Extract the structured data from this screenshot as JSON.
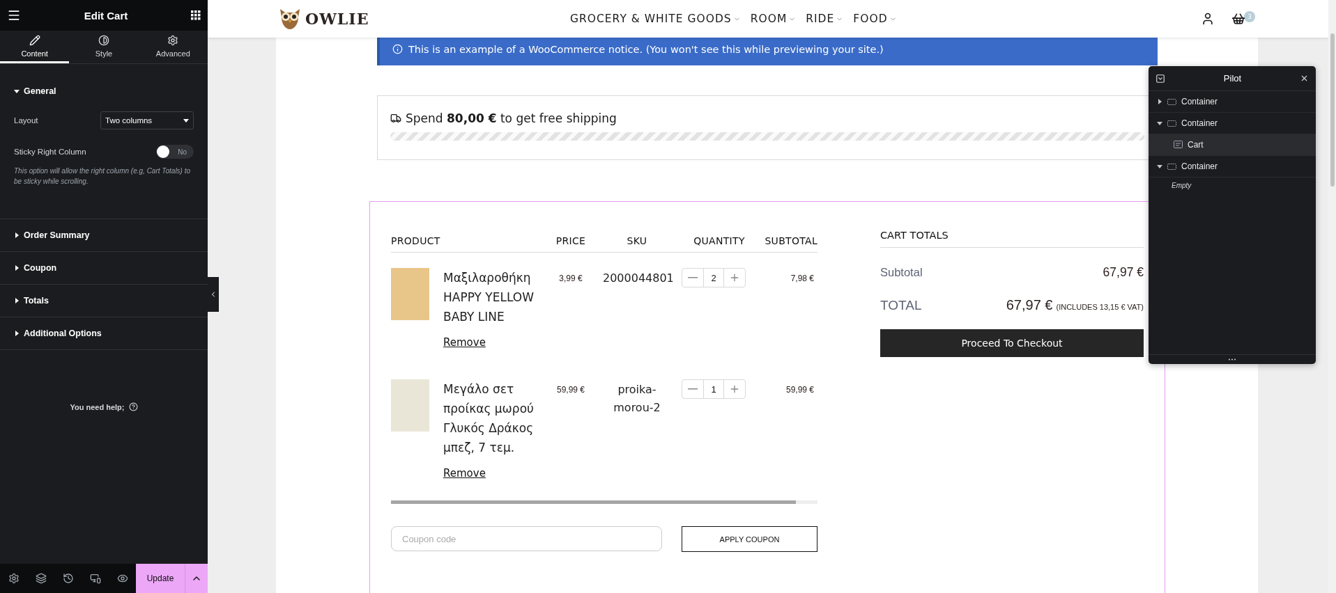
{
  "editor_panel": {
    "title": "Edit Cart",
    "tabs": [
      {
        "label": "Content",
        "kind": "pencil",
        "selected": true
      },
      {
        "label": "Style",
        "kind": "contrast",
        "selected": false
      },
      {
        "label": "Advanced",
        "kind": "gear",
        "selected": false
      }
    ],
    "sections": [
      {
        "title": "General",
        "expanded": true,
        "controls": [
          {
            "kind": "select",
            "label": "Layout",
            "value": "Two columns"
          },
          {
            "kind": "switch",
            "label": "Sticky Right Column",
            "on": false,
            "state_label": "No"
          },
          {
            "kind": "note",
            "text": "This option will allow the right column (e.g, Cart Totals) to be sticky while scrolling."
          }
        ]
      },
      {
        "title": "Order Summary",
        "expanded": false
      },
      {
        "title": "Coupon",
        "expanded": false
      },
      {
        "title": "Totals",
        "expanded": false
      },
      {
        "title": "Additional Options",
        "expanded": false
      }
    ],
    "help_link": "You need help;",
    "footer": {
      "update_label": "Update"
    }
  },
  "site_header": {
    "logo": "OWLIE",
    "nav": [
      "GROCERY & WHITE GOODS",
      "ROOM",
      "RIDE",
      "FOOD"
    ],
    "cart_count": "3"
  },
  "notice": "This is an example of a WooCommerce notice. (You won't see this while previewing your site.)",
  "shipping": {
    "text": "Spend **80,00 €** to get free shipping",
    "level": 1
  },
  "cart": {
    "columns": [
      "PRODUCT",
      "PRICE",
      "SKU",
      "QUANTITY",
      "SUBTOTAL"
    ],
    "rows": [
      {
        "name": "Μαξιλαροθήκη HAPPY YELLOW BABY LINE",
        "price": "3,99 €",
        "sku": "2000044801",
        "quantity": "2",
        "subtotal": "7,98 €",
        "remove": "Remove",
        "color": "#e8c68a"
      },
      {
        "name": "Μεγάλο σετ προίκας μωρού Γλυκός Δράκος μπεζ, 7 τεμ.",
        "price": "59,99 €",
        "sku": "proika-morou-2",
        "quantity": "1",
        "subtotal": "59,99 €",
        "remove": "Remove",
        "color": "#e9e6d8"
      }
    ],
    "coupon_placeholder": "Coupon code",
    "apply_button": "APPLY COUPON"
  },
  "totals": {
    "title": "CART TOTALS",
    "subtotal_label": "Subtotal",
    "subtotal_value": "67,97 €",
    "total_label": "TOTAL",
    "total_value": "67,97 €",
    "total_note": "(INCLUDES 13,15 € VAT)",
    "checkout_button": "Proceed To Checkout"
  },
  "pilot": {
    "title": "Pilot",
    "items": [
      {
        "label": "Container",
        "kind": "container",
        "expanded": false,
        "selected": false
      },
      {
        "label": "Container",
        "kind": "container",
        "expanded": true,
        "selected": false,
        "children": [
          {
            "label": "Cart",
            "kind": "widget",
            "selected": true
          }
        ]
      },
      {
        "label": "Container",
        "kind": "container",
        "expanded": true,
        "selected": false,
        "empty_label": "Empty"
      }
    ]
  }
}
